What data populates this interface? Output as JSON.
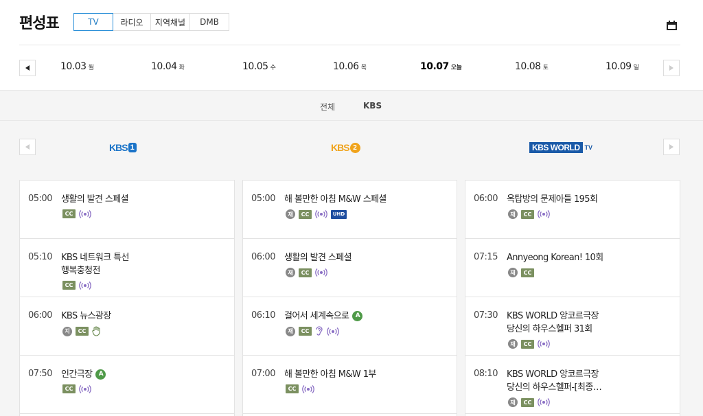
{
  "header": {
    "title": "편성표",
    "tabs": [
      {
        "label": "TV",
        "active": true
      },
      {
        "label": "라디오",
        "active": false
      },
      {
        "label": "지역채널",
        "active": false
      },
      {
        "label": "DMB",
        "active": false
      }
    ],
    "calendar_icon": "calendar-icon"
  },
  "dates": [
    {
      "date": "10.03",
      "day": "월"
    },
    {
      "date": "10.04",
      "day": "화"
    },
    {
      "date": "10.05",
      "day": "수"
    },
    {
      "date": "10.06",
      "day": "목"
    },
    {
      "date": "10.07",
      "day": "오늘",
      "today": true
    },
    {
      "date": "10.08",
      "day": "토"
    },
    {
      "date": "10.09",
      "day": "일"
    }
  ],
  "filters": [
    {
      "label": "전체"
    },
    {
      "label": "KBS",
      "active": true
    }
  ],
  "channels": [
    {
      "logo_text": "KBS",
      "logo_num": "1",
      "color": "#1a73c8",
      "programs": [
        {
          "time": "05:00",
          "title": "생활의 발견 스페셜",
          "badges": [
            "cc",
            "live"
          ]
        },
        {
          "time": "05:10",
          "title": "KBS 네트워크 특선",
          "title2": "행복충청전",
          "badges": [
            "cc",
            "live"
          ]
        },
        {
          "time": "06:00",
          "title": "KBS 뉴스광장",
          "badges": [
            "ji",
            "cc",
            "sign"
          ]
        },
        {
          "time": "07:50",
          "title": "인간극장",
          "age": "A",
          "badges": [
            "cc",
            "live"
          ]
        }
      ]
    },
    {
      "logo_text": "KBS",
      "logo_num": "2",
      "color": "#f0a31b",
      "programs": [
        {
          "time": "05:00",
          "title": "해 볼만한 아침 M&W 스페셜",
          "badges": [
            "re",
            "cc",
            "live",
            "uhd"
          ]
        },
        {
          "time": "06:00",
          "title": "생활의 발견 스페셜",
          "badges": [
            "re",
            "cc",
            "live"
          ]
        },
        {
          "time": "06:10",
          "title": "걸어서 세계속으로",
          "age": "A",
          "badges": [
            "re",
            "cc",
            "ear",
            "live"
          ]
        },
        {
          "time": "07:00",
          "title": "해 볼만한 아침 M&W 1부",
          "badges": [
            "cc",
            "live"
          ]
        }
      ]
    },
    {
      "logo_text": "KBS WORLD",
      "logo_suffix": "TV",
      "color": "#1a5aa8",
      "programs": [
        {
          "time": "06:00",
          "title": "옥탑방의 문제아들 195회",
          "badges": [
            "re",
            "cc",
            "live"
          ]
        },
        {
          "time": "07:15",
          "title": "Annyeong Korean! 10회",
          "badges": [
            "re",
            "cc"
          ]
        },
        {
          "time": "07:30",
          "title": "KBS WORLD 앙코르극장",
          "title2": "당신의 하우스헬퍼 31회",
          "badges": [
            "re",
            "cc",
            "live"
          ]
        },
        {
          "time": "08:10",
          "title": "KBS WORLD 앙코르극장",
          "title2": "당신의 하우스헬퍼-[최종…",
          "badges": [
            "re",
            "cc",
            "live"
          ]
        }
      ]
    }
  ],
  "badge_labels": {
    "cc": "CC",
    "uhd": "UHD",
    "re": "재",
    "ji": "지"
  },
  "colors": {
    "accent": "#1a78c2",
    "cc": "#7b9060",
    "uhd": "#1f4ea0",
    "age": "#4f9a48",
    "live": "#8a6fc4"
  }
}
